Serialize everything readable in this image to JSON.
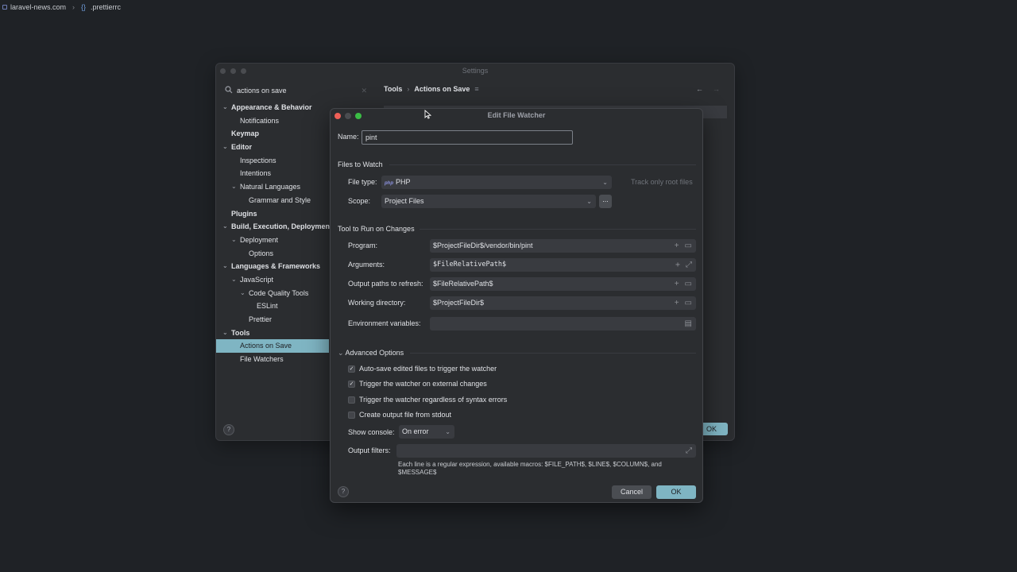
{
  "topbar": {
    "project": "laravel-news.com",
    "braces": "{}",
    "file": ".prettierrc"
  },
  "settings": {
    "title": "Settings",
    "search_value": "actions on save",
    "breadcrumb_tools": "Tools",
    "breadcrumb_page": "Actions on Save",
    "tree": [
      {
        "label": "Appearance & Behavior",
        "bold": true,
        "depth": 0,
        "chev": "open"
      },
      {
        "label": "Notifications",
        "depth": 1
      },
      {
        "label": "Keymap",
        "bold": true,
        "depth": 0
      },
      {
        "label": "Editor",
        "bold": true,
        "depth": 0,
        "chev": "open"
      },
      {
        "label": "Inspections",
        "depth": 1
      },
      {
        "label": "Intentions",
        "depth": 1
      },
      {
        "label": "Natural Languages",
        "depth": 1,
        "chev": "open"
      },
      {
        "label": "Grammar and Style",
        "depth": 2
      },
      {
        "label": "Plugins",
        "bold": true,
        "depth": 0
      },
      {
        "label": "Build, Execution, Deployment",
        "bold": true,
        "depth": 0,
        "chev": "open"
      },
      {
        "label": "Deployment",
        "depth": 1,
        "chev": "open"
      },
      {
        "label": "Options",
        "depth": 2
      },
      {
        "label": "Languages & Frameworks",
        "bold": true,
        "depth": 0,
        "chev": "open"
      },
      {
        "label": "JavaScript",
        "depth": 1,
        "chev": "open"
      },
      {
        "label": "Code Quality Tools",
        "depth": 2,
        "chev": "open"
      },
      {
        "label": "ESLint",
        "depth": 3
      },
      {
        "label": "Prettier",
        "depth": 2
      },
      {
        "label": "Tools",
        "bold": true,
        "depth": 0,
        "chev": "open"
      },
      {
        "label": "Actions on Save",
        "depth": 1,
        "selected": true
      },
      {
        "label": "File Watchers",
        "depth": 1
      }
    ],
    "ok_label": "OK"
  },
  "dialog": {
    "title": "Edit File Watcher",
    "name_label": "Name:",
    "name_value": "pint",
    "files_section": "Files to Watch",
    "file_type_label": "File type:",
    "file_type_badge": "php",
    "file_type_value": "PHP",
    "track_root": "Track only root files",
    "scope_label": "Scope:",
    "scope_value": "Project Files",
    "scope_button": "...",
    "tool_section": "Tool to Run on Changes",
    "program_label": "Program:",
    "program_value": "$ProjectFileDir$/vendor/bin/pint",
    "arguments_label": "Arguments:",
    "arguments_value": "$FileRelativePath$",
    "output_label": "Output paths to refresh:",
    "output_value": "$FileRelativePath$",
    "workdir_label": "Working directory:",
    "workdir_value": "$ProjectFileDir$",
    "env_label": "Environment variables:",
    "advanced_section": "Advanced Options",
    "checkboxes": [
      {
        "label": "Auto-save edited files to trigger the watcher",
        "checked": true
      },
      {
        "label": "Trigger the watcher on external changes",
        "checked": true
      },
      {
        "label": "Trigger the watcher regardless of syntax errors",
        "checked": false
      },
      {
        "label": "Create output file from stdout",
        "checked": false
      }
    ],
    "console_label": "Show console:",
    "console_value": "On error",
    "filters_label": "Output filters:",
    "hint_line1": "Each line is a regular expression, available macros: $FILE_PATH$, $LINE$, $COLUMN$, and",
    "hint_line2": "$MESSAGE$",
    "cancel_label": "Cancel",
    "ok_label": "OK",
    "help_label": "?"
  },
  "colors": {
    "accent": "#7fb5c3",
    "background": "#1f2226",
    "panel": "#2b2d30",
    "field": "#393b40"
  },
  "icons": [
    "search-icon",
    "clear-icon",
    "chevron-down-icon",
    "chevron-right-icon",
    "back-arrow-icon",
    "forward-arrow-icon",
    "add-icon",
    "folder-icon",
    "expand-icon",
    "clipboard-icon",
    "help-icon",
    "mouse-cursor-icon"
  ]
}
